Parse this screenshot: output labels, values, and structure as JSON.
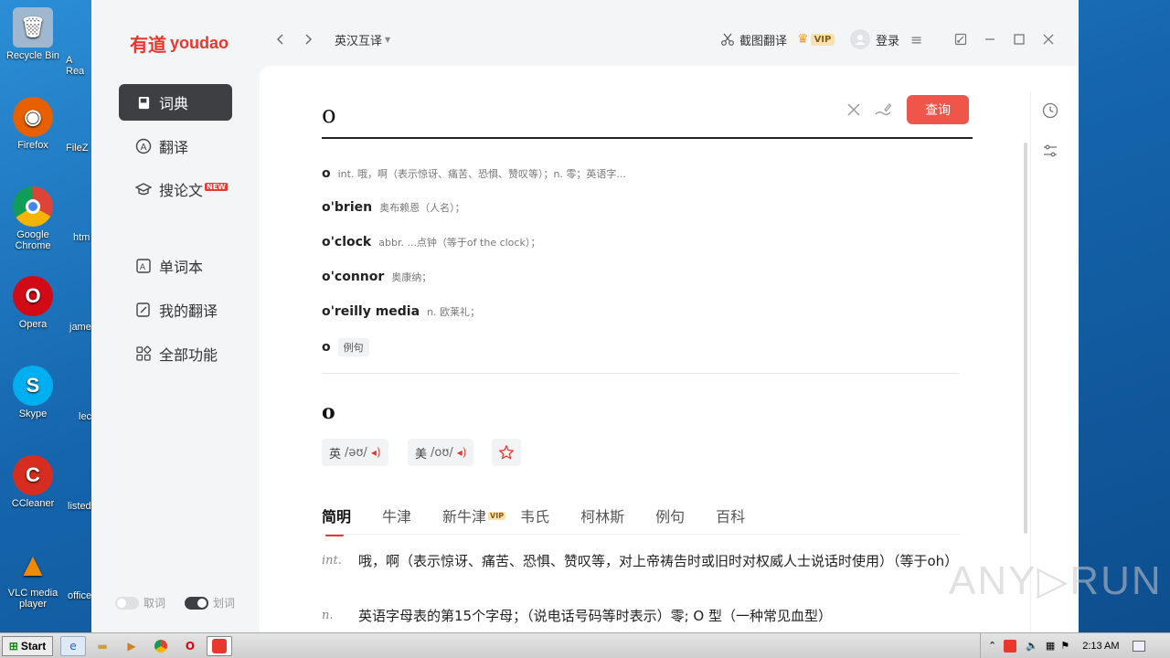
{
  "desktop": {
    "icons": [
      {
        "label": "Recycle Bin",
        "glyph": "🗑"
      },
      {
        "label": "Firefox",
        "glyph": "🦊"
      },
      {
        "label": "Google Chrome",
        "glyph": "●"
      },
      {
        "label": "Opera",
        "glyph": "O"
      },
      {
        "label": "Skype",
        "glyph": "S"
      },
      {
        "label": "CCleaner",
        "glyph": "C"
      },
      {
        "label": "VLC media player",
        "glyph": "▲"
      }
    ],
    "partial_labels": [
      "A Rea",
      "FileZ",
      "htm",
      "jame",
      "lec",
      "listed",
      "office"
    ]
  },
  "app": {
    "logo_mark": "有道",
    "logo_word": "youdao",
    "nav": [
      {
        "label": "词典",
        "icon": "book-icon"
      },
      {
        "label": "翻译",
        "icon": "translate-icon"
      },
      {
        "label": "搜论文",
        "icon": "graduation-cap-icon",
        "badge": "NEW"
      },
      {
        "label": "单词本",
        "icon": "wordbook-icon"
      },
      {
        "label": "我的翻译",
        "icon": "edit-icon"
      },
      {
        "label": "全部功能",
        "icon": "grid-icon"
      }
    ],
    "toggles": [
      {
        "label": "取词",
        "on": false
      },
      {
        "label": "划词",
        "on": true
      }
    ],
    "topbar": {
      "lang_mode": "英汉互译",
      "screenshot_translate": "截图翻译",
      "vip": "VIP",
      "login": "登录"
    },
    "search": {
      "query": "o",
      "button": "查询"
    },
    "suggestions": [
      {
        "word": "o",
        "def": "int. 哦，啊（表示惊讶、痛苦、恐惧、赞叹等）；n. 零；英语字..."
      },
      {
        "word": "o'brien",
        "def": "奥布赖恩（人名）；"
      },
      {
        "word": "o'clock",
        "def": "abbr. ...点钟（等于of the clock）；"
      },
      {
        "word": "o'connor",
        "def": "奥康纳；"
      },
      {
        "word": "o'reilly media",
        "def": "n. 欧莱礼；"
      },
      {
        "word": "o",
        "def": "例句"
      }
    ],
    "entry": {
      "headword": "o",
      "pron_uk_label": "英",
      "pron_uk": "/əʊ/",
      "pron_us_label": "美",
      "pron_us": "/oʊ/"
    },
    "tabs": [
      "简明",
      "牛津",
      "新牛津",
      "韦氏",
      "柯林斯",
      "例句",
      "百科"
    ],
    "tab_vip": "VIP",
    "definitions": [
      {
        "pos": "int.",
        "text": "哦，啊（表示惊讶、痛苦、恐惧、赞叹等，对上帝祷告时或旧时对权威人士说话时使用）（等于oh）"
      },
      {
        "pos": "n.",
        "text": "英语字母表的第15个字母；（说电话号码等时表示）零; O 型（一种常见血型）"
      }
    ]
  },
  "watermark": "ANY▷RUN",
  "taskbar": {
    "start": "Start",
    "clock": "2:13 AM"
  },
  "colors": {
    "accent": "#e8372c",
    "button": "#f0554a",
    "sidebar_active": "#3d3f43"
  }
}
